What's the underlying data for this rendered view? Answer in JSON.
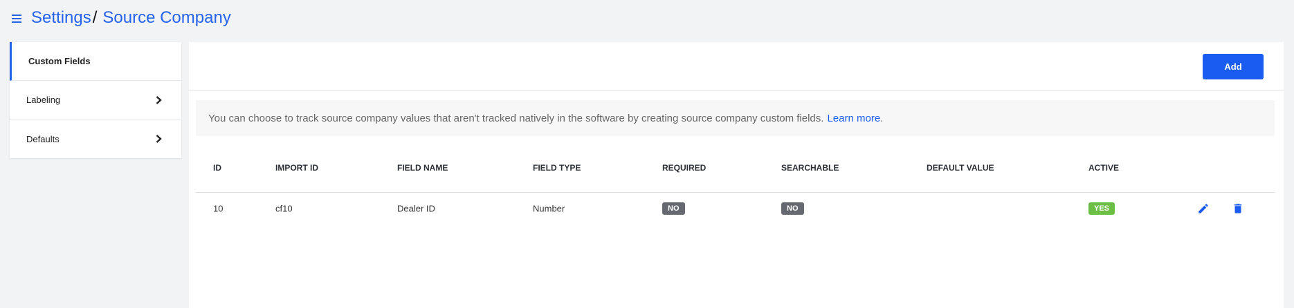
{
  "header": {
    "breadcrumb_root": "Settings",
    "breadcrumb_separator": "/",
    "breadcrumb_current": "Source Company",
    "menu_icon": "hamburger-menu-icon"
  },
  "sidebar": {
    "items": [
      {
        "label": "Custom Fields",
        "active": true
      },
      {
        "label": "Labeling",
        "icon": "chevron-right-icon"
      },
      {
        "label": "Defaults",
        "icon": "chevron-right-icon"
      }
    ]
  },
  "toolbar": {
    "add_label": "Add"
  },
  "info": {
    "text": "You can choose to track source company values that aren't tracked natively in the software by creating source company custom fields.",
    "link": "Learn more",
    "suffix": "."
  },
  "table": {
    "columns": [
      "ID",
      "IMPORT ID",
      "FIELD NAME",
      "FIELD TYPE",
      "REQUIRED",
      "SEARCHABLE",
      "DEFAULT VALUE",
      "ACTIVE"
    ],
    "rows": [
      {
        "id": "10",
        "import_id": "cf10",
        "field_name": "Dealer ID",
        "field_type": "Number",
        "required": "NO",
        "searchable": "NO",
        "default_value": "",
        "active": "YES"
      }
    ]
  },
  "colors": {
    "accent": "#1a5cf0",
    "badge_no": "#666a70",
    "badge_yes": "#6bbf45"
  }
}
